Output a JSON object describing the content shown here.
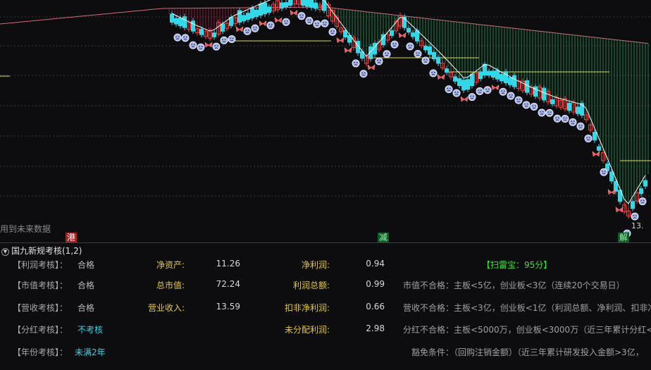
{
  "chart": {
    "future_data_warning": "用到未来数据",
    "tags": [
      {
        "text": "港",
        "color": "red"
      },
      {
        "text": "减",
        "color": "green"
      },
      {
        "text": "解",
        "color": "green"
      }
    ],
    "right_price_label": "13.",
    "colors": {
      "up": "#ff3b3b",
      "down": "#33d8e8",
      "ma": "#ffffff",
      "support": "#e6e030",
      "upper_band": "#d9687a"
    }
  },
  "panel": {
    "title": "国九新规考核(1,2)",
    "checks": [
      {
        "label": "【利润考核】：",
        "value": "合格"
      },
      {
        "label": "【市值考核】：",
        "value": "合格"
      },
      {
        "label": "【营收考核】：",
        "value": "合格"
      },
      {
        "label": "【分红考核】：",
        "value": "不考核"
      },
      {
        "label": "【年份考核】：",
        "value": "未满2年"
      }
    ],
    "metrics_a": [
      {
        "label": "净资产:",
        "value": "11.26"
      },
      {
        "label": "总市值:",
        "value": "72.24"
      },
      {
        "label": "营业收入:",
        "value": "13.59"
      }
    ],
    "metrics_b": [
      {
        "label": "净利润:",
        "value": "0.94"
      },
      {
        "label": "利润总额:",
        "value": "0.99"
      },
      {
        "label": "扣非净利润:",
        "value": "0.66"
      },
      {
        "label": "未分配利润:",
        "value": "2.98"
      }
    ],
    "score": "【扫雷宝：95分】",
    "notes": [
      "市值不合格：主板<5亿，创业板<3亿（连续20个交易日）",
      "营收不合格：主板<3亿，创业板<1亿（利润总额、净利润、扣非净",
      "分红不合格：主板<5000万，创业板<3000万（近三年累计分红<年",
      "豁免条件：（回购注销金额）（近三年累计研发投入金额>3亿，"
    ]
  }
}
